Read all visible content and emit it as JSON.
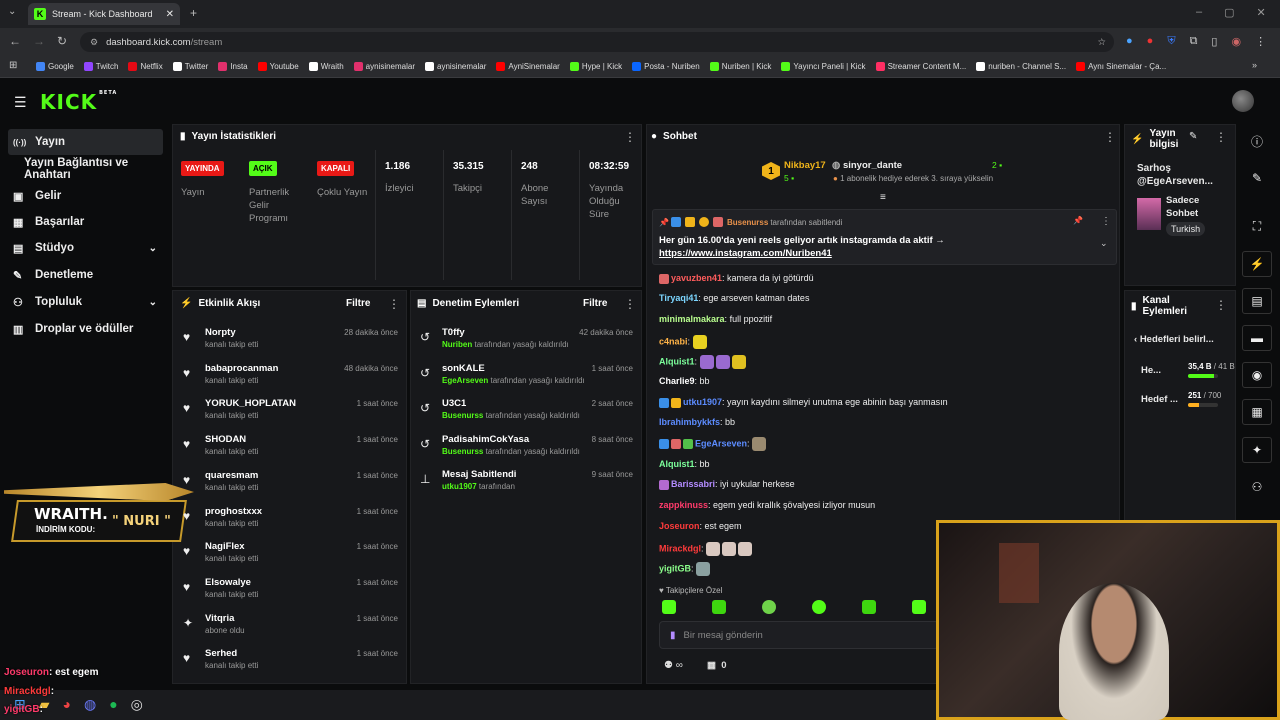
{
  "browser": {
    "tab_title": "Stream - Kick Dashboard",
    "url_domain": "dashboard.kick.com",
    "url_path": "/stream",
    "bookmarks": [
      {
        "label": "Google",
        "color": "#4285f4"
      },
      {
        "label": "Twitch",
        "color": "#9146ff"
      },
      {
        "label": "Netflix",
        "color": "#e50914"
      },
      {
        "label": "Twitter",
        "color": "#ffffff"
      },
      {
        "label": "Insta",
        "color": "#e1306c"
      },
      {
        "label": "Youtube",
        "color": "#ff0000"
      },
      {
        "label": "Wraith",
        "color": "#ffffff"
      },
      {
        "label": "aynisinemalar",
        "color": "#e1306c"
      },
      {
        "label": "aynisinemalar",
        "color": "#ffffff"
      },
      {
        "label": "AyniSinemalar",
        "color": "#ff0000"
      },
      {
        "label": "Hype | Kick",
        "color": "#53fc18"
      },
      {
        "label": "Posta - Nuriben",
        "color": "#0a66ff"
      },
      {
        "label": "Nuriben | Kick",
        "color": "#53fc18"
      },
      {
        "label": "Yayıncı Paneli | Kick",
        "color": "#53fc18"
      },
      {
        "label": "Streamer Content M...",
        "color": "#ff2e63"
      },
      {
        "label": "nuriben - Channel S...",
        "color": "#ffffff"
      },
      {
        "label": "Aynı Sinemalar - Ça...",
        "color": "#ff0000"
      }
    ]
  },
  "app": {
    "logo": "KICK",
    "beta": "BETA"
  },
  "sidebar": {
    "items": [
      {
        "label": "Yayın",
        "icon": "broadcast-icon"
      },
      {
        "label": "Yayın Bağlantısı ve Anahtarı",
        "icon": ""
      },
      {
        "label": "Gelir",
        "icon": "wallet-icon"
      },
      {
        "label": "Başarılar",
        "icon": "trophy-icon"
      },
      {
        "label": "Stüdyo",
        "icon": "studio-icon"
      },
      {
        "label": "Denetleme",
        "icon": "wrench-icon"
      },
      {
        "label": "Topluluk",
        "icon": "people-icon"
      },
      {
        "label": "Droplar ve ödüller",
        "icon": "gift-icon"
      }
    ]
  },
  "stats": {
    "title": "Yayın İstatistikleri",
    "tags": [
      {
        "tag": "YAYINDA",
        "label": "Yayın",
        "color": "#e91916"
      },
      {
        "tag": "AÇIK",
        "label": "Partnerlik Gelir Programı",
        "color": "#53fc18"
      },
      {
        "tag": "KAPALI",
        "label": "Çoklu Yayın",
        "color": "#e91916"
      }
    ],
    "values": [
      {
        "value": "1.186",
        "label": "İzleyici"
      },
      {
        "value": "35.315",
        "label": "Takipçi"
      },
      {
        "value": "248",
        "label": "Abone Sayısı"
      },
      {
        "value": "08:32:59",
        "label": "Yayında Olduğu Süre"
      }
    ]
  },
  "activity": {
    "title": "Etkinlik Akışı",
    "filter": "Filtre",
    "items": [
      {
        "name": "Norpty",
        "sub": "kanalı takip etti",
        "time": "28 dakika önce"
      },
      {
        "name": "babaprocanman",
        "sub": "kanalı takip etti",
        "time": "48 dakika önce"
      },
      {
        "name": "YORUK_HOPLATAN",
        "sub": "kanalı takip etti",
        "time": "1 saat önce"
      },
      {
        "name": "SHODAN",
        "sub": "kanalı takip etti",
        "time": "1 saat önce"
      },
      {
        "name": "quaresmam",
        "sub": "kanalı takip etti",
        "time": "1 saat önce"
      },
      {
        "name": "proghostxxx",
        "sub": "kanalı takip etti",
        "time": "1 saat önce"
      },
      {
        "name": "NagiFlex",
        "sub": "kanalı takip etti",
        "time": "1 saat önce"
      },
      {
        "name": "Elsowalye",
        "sub": "kanalı takip etti",
        "time": "1 saat önce"
      },
      {
        "name": "Vitqria",
        "sub": "abone oldu",
        "time": "1 saat önce"
      },
      {
        "name": "Serhed",
        "sub": "kanalı takip etti",
        "time": "1 saat önce"
      }
    ]
  },
  "moderation": {
    "title": "Denetim Eylemleri",
    "filter": "Filtre",
    "items": [
      {
        "name": "T0ffy",
        "by": "Nuriben",
        "action": "tarafından yasağı kaldırıldı",
        "time": "42 dakika önce"
      },
      {
        "name": "sonKALE",
        "by": "EgeArseven",
        "action": "tarafından yasağı kaldırıldı",
        "time": "1 saat önce"
      },
      {
        "name": "U3C1",
        "by": "Busenurss",
        "action": "tarafından yasağı kaldırıldı",
        "time": "2 saat önce"
      },
      {
        "name": "PadisahimCokYasa",
        "by": "Busenurss",
        "action": "tarafından yasağı kaldırıldı",
        "time": "8 saat önce"
      },
      {
        "name": "Mesaj Sabitlendi",
        "by": "utku1907",
        "action": "tarafından",
        "time": "9 saat önce"
      }
    ]
  },
  "chat": {
    "title": "Sohbet",
    "leader": {
      "name": "Nikbay17",
      "count": "5",
      "second": "sinyor_dante",
      "second_count": "2",
      "note": "1 abonelik hediye ederek 3. sıraya yükselin"
    },
    "pinned": {
      "by": "Busenurss",
      "by_suffix": "tarafından sabitlendi",
      "text": "Her gün 16.00'da yeni reels geliyor artık instagramda da aktif →",
      "link": "https://www.instagram.com/Nuriben41"
    },
    "messages": [
      {
        "user": "yavuzben41",
        "color": "#ff5c5c",
        "text": "kamera da iyi götürdü"
      },
      {
        "user": "Tiryaqi41",
        "color": "#7cd6ff",
        "text": "ege arseven katman dates"
      },
      {
        "user": "minimalmakara",
        "color": "#b9ff8f",
        "text": "full ppozitif"
      },
      {
        "user": "c4nabi",
        "color": "#ffb347",
        "text": ""
      },
      {
        "user": "Alquist1",
        "color": "#7cff9b",
        "text": ""
      },
      {
        "user": "Charlie9",
        "color": "#ffffff",
        "text": "bb"
      },
      {
        "user": "utku1907",
        "color": "#5c8cff",
        "text": "yayın kaydını silmeyi unutma ege abinin başı yanmasın"
      },
      {
        "user": "Ibrahimbykkfs",
        "color": "#5c8cff",
        "text": "bb"
      },
      {
        "user": "EgeArseven",
        "color": "#5c8cff",
        "text": ""
      },
      {
        "user": "Alquist1",
        "color": "#7cff9b",
        "text": "bb"
      },
      {
        "user": "Barissabri",
        "color": "#b38cff",
        "text": "iyi uykular herkese"
      },
      {
        "user": "zappkinuss",
        "color": "#ff3b6b",
        "text": "egem yedi krallık şövalyesi izliyor musun"
      },
      {
        "user": "Joseuron",
        "color": "#ff3b3b",
        "text": "est egem"
      },
      {
        "user": "Mirackdgl",
        "color": "#ff3b3b",
        "text": ""
      },
      {
        "user": "yigitGB",
        "color": "#8cff8c",
        "text": ""
      }
    ],
    "followers_only": "Takipçilere Özel",
    "input_placeholder": "Bir mesaj gönderin",
    "points": "0"
  },
  "stream_info": {
    "title": "Yayın bilgisi",
    "stream_title": "Sarhoş @EgeArseven...",
    "category": "Sadece Sohbet",
    "language": "Turkish"
  },
  "channel_actions": {
    "title": "Kanal Eylemleri",
    "goals_title": "Hedefleri belirl...",
    "goals": [
      {
        "label": "He...",
        "current": "35,4 B",
        "target": "41 B",
        "progress": 0.86,
        "color": "#53fc18"
      },
      {
        "label": "Hedef ...",
        "current": "251",
        "target": "700",
        "progress": 0.36,
        "color": "#ffb020"
      }
    ]
  },
  "overlay": {
    "brand": "WRAITH.",
    "code_label": "İNDİRİM KODU:",
    "code": "\" NURI \"",
    "chat_lines": [
      {
        "user": "Joseuron",
        "text": ": est egem"
      },
      {
        "user": "Mirackdgl",
        "text": ":"
      },
      {
        "user": "yigitGB",
        "text": ":"
      }
    ]
  }
}
